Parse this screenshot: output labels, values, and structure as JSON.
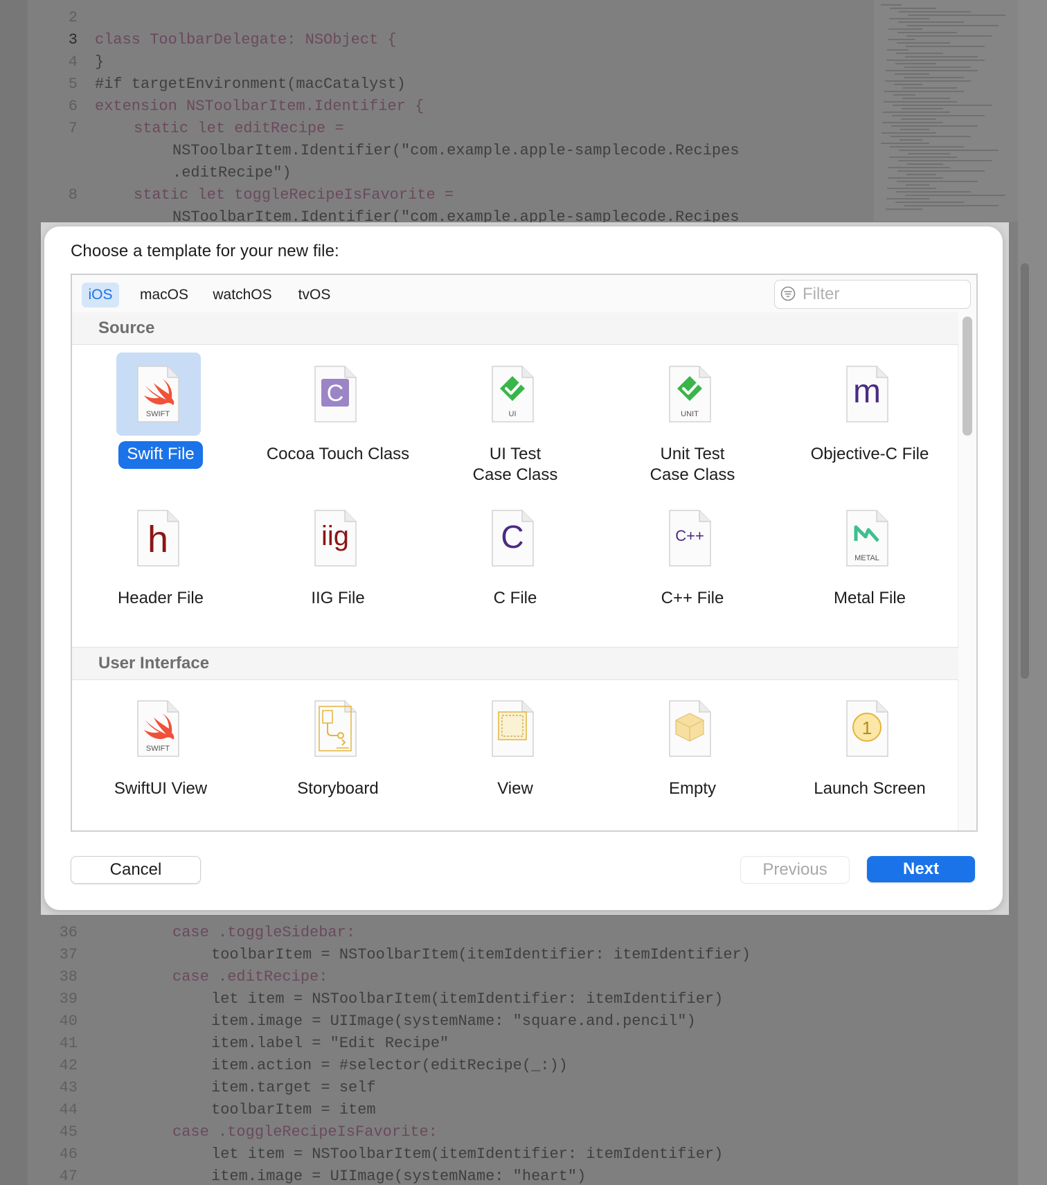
{
  "editor": {
    "top_lines": [
      {
        "n": "2",
        "text": ""
      },
      {
        "n": "3",
        "text": "class ToolbarDelegate: NSObject {"
      },
      {
        "n": "4",
        "text": "}"
      },
      {
        "n": "5",
        "text": "#if targetEnvironment(macCatalyst)"
      },
      {
        "n": "6",
        "text": "extension NSToolbarItem.Identifier {"
      },
      {
        "n": "7",
        "text": "static let editRecipe ="
      },
      {
        "n": "",
        "text": "NSToolbarItem.Identifier(\"com.example.apple-samplecode.Recipes"
      },
      {
        "n": "",
        "text": ".editRecipe\")"
      },
      {
        "n": "8",
        "text": "static let toggleRecipeIsFavorite ="
      },
      {
        "n": "",
        "text": "NSToolbarItem.Identifier(\"com.example.apple-samplecode.Recipes"
      }
    ],
    "bottom_lines": [
      {
        "n": "36",
        "text": "case .toggleSidebar:"
      },
      {
        "n": "37",
        "text": "toolbarItem = NSToolbarItem(itemIdentifier: itemIdentifier)"
      },
      {
        "n": "38",
        "text": "case .editRecipe:"
      },
      {
        "n": "39",
        "text": "let item = NSToolbarItem(itemIdentifier: itemIdentifier)"
      },
      {
        "n": "40",
        "text": "item.image = UIImage(systemName: \"square.and.pencil\")"
      },
      {
        "n": "41",
        "text": "item.label = \"Edit Recipe\""
      },
      {
        "n": "42",
        "text": "item.action = #selector(editRecipe(_:))"
      },
      {
        "n": "43",
        "text": "item.target = self"
      },
      {
        "n": "44",
        "text": "toolbarItem = item"
      },
      {
        "n": "45",
        "text": "case .toggleRecipeIsFavorite:"
      },
      {
        "n": "46",
        "text": "let item = NSToolbarItem(itemIdentifier: itemIdentifier)"
      },
      {
        "n": "47",
        "text": "item.image = UIImage(systemName: \"heart\")"
      }
    ]
  },
  "dialog": {
    "title": "Choose a template for your new file:",
    "tabs": [
      {
        "label": "iOS",
        "active": true
      },
      {
        "label": "macOS",
        "active": false
      },
      {
        "label": "watchOS",
        "active": false
      },
      {
        "label": "tvOS",
        "active": false
      }
    ],
    "filter": {
      "placeholder": "Filter",
      "value": ""
    },
    "sections": [
      {
        "title": "Source",
        "items": [
          {
            "label": "Swift File",
            "icon": "swift-icon",
            "caption": "SWIFT",
            "selected": true
          },
          {
            "label": "Cocoa Touch Class",
            "icon": "cocoa-touch-class-icon",
            "glyph": "C"
          },
          {
            "label": "UI Test Case Class",
            "icon": "ui-test-icon",
            "caption": "UI"
          },
          {
            "label": "Unit Test Case Class",
            "icon": "unit-test-icon",
            "caption": "UNIT"
          },
          {
            "label": "Objective-C File",
            "icon": "objc-file-icon",
            "glyph": "m"
          },
          {
            "label": "Header File",
            "icon": "header-file-icon",
            "glyph": "h"
          },
          {
            "label": "IIG File",
            "icon": "iig-file-icon",
            "glyph": "iig"
          },
          {
            "label": "C File",
            "icon": "c-file-icon",
            "glyph": "C"
          },
          {
            "label": "C++ File",
            "icon": "cpp-file-icon",
            "glyph": "C++"
          },
          {
            "label": "Metal File",
            "icon": "metal-file-icon",
            "caption": "METAL"
          }
        ]
      },
      {
        "title": "User Interface",
        "items": [
          {
            "label": "SwiftUI View",
            "icon": "swiftui-icon",
            "caption": "SWIFT"
          },
          {
            "label": "Storyboard",
            "icon": "storyboard-icon"
          },
          {
            "label": "View",
            "icon": "view-icon"
          },
          {
            "label": "Empty",
            "icon": "empty-icon"
          },
          {
            "label": "Launch Screen",
            "icon": "launch-screen-icon",
            "glyph": "1"
          }
        ]
      }
    ],
    "buttons": {
      "cancel": "Cancel",
      "previous": "Previous",
      "next": "Next"
    }
  },
  "colors": {
    "accent": "#1a73e8",
    "selection": "#c9dcf5",
    "swift_orange": "#f05138",
    "check_green": "#3ab54a",
    "cocoa_purple": "#9b85c6",
    "objc_purple": "#4b2a84",
    "header_red": "#8c1515",
    "metal_green": "#3fbf8f",
    "storyboard_gold": "#e4b43c"
  }
}
